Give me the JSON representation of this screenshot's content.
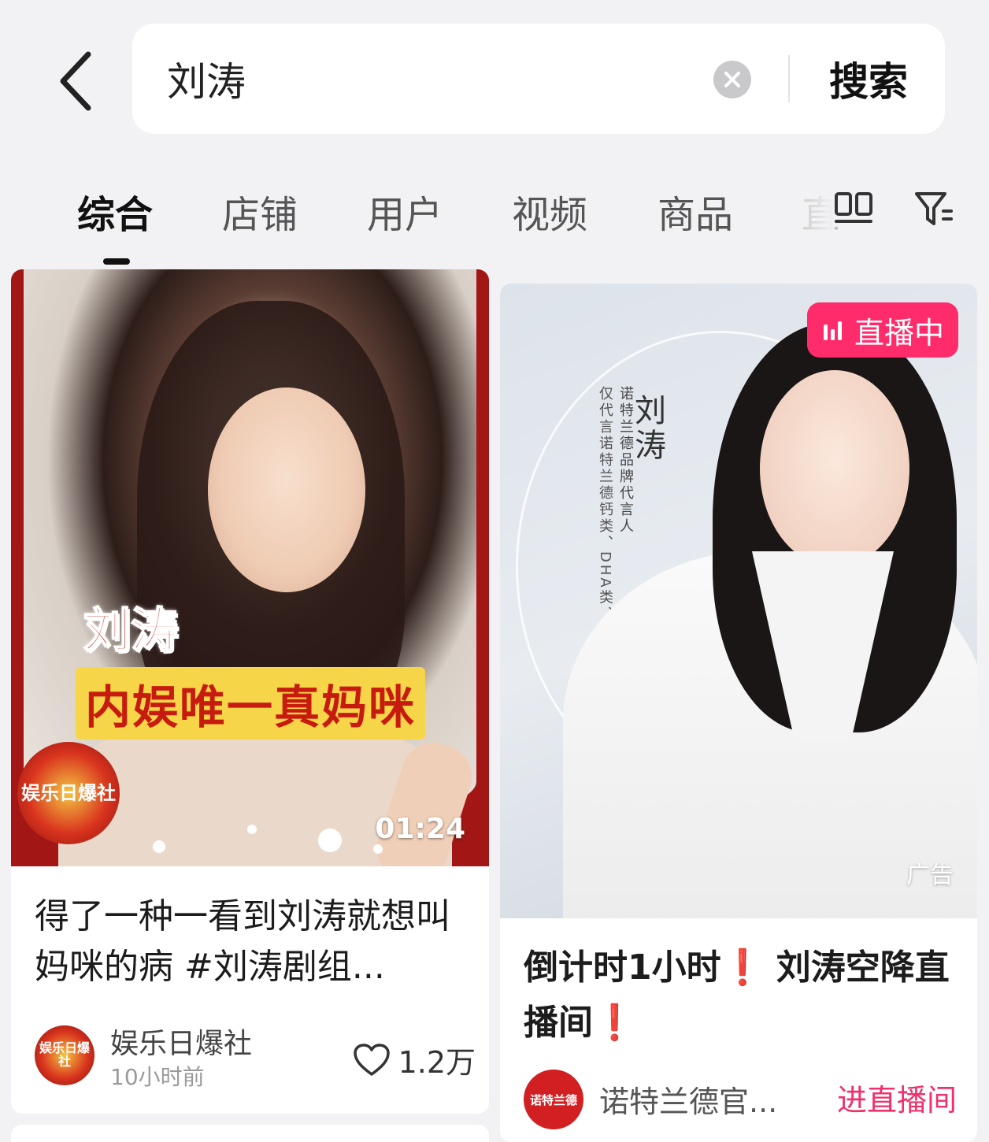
{
  "search": {
    "query": "刘涛",
    "button_label": "搜索"
  },
  "tabs": [
    {
      "label": "综合",
      "active": true
    },
    {
      "label": "店铺",
      "active": false
    },
    {
      "label": "用户",
      "active": false
    },
    {
      "label": "视频",
      "active": false
    },
    {
      "label": "商品",
      "active": false
    },
    {
      "label": "直",
      "active": false
    }
  ],
  "icons": {
    "back": "chevron-left-icon",
    "clear": "clear-circle-icon",
    "layout_toggle": "double-column-layout-icon",
    "filter": "filter-funnel-icon",
    "like": "heart-outline-icon",
    "live": "live-bars-icon"
  },
  "colors": {
    "background": "#f2f2f4",
    "live_badge": "#ff2b6a",
    "live_link": "#f0306c",
    "exclamation": "#e02828",
    "video_frame": "#a31616"
  },
  "cards": {
    "left": {
      "overlay_name": "刘涛",
      "overlay_sub": "内娱唯一真妈咪",
      "logo_text": "娱乐日爆社",
      "duration": "01:24",
      "title": "得了一种一看到刘涛就想叫妈咪的病 #刘涛剧组...",
      "author": "娱乐日爆社",
      "time": "10小时前",
      "likes": "1.2万"
    },
    "right": {
      "live_badge": "直播中",
      "brand_line1": "仅代言诺特兰德钙类、DHA类、益生菌类系列产品",
      "brand_line2": "诺特兰德品牌代言人",
      "brand_name": "刘涛",
      "ad_label": "广告",
      "title_part1": "倒计时1小时",
      "title_part2": "刘涛空降直播间",
      "exclamation": "❗",
      "author": "诺特兰德官...",
      "avatar_text": "诺特兰德",
      "action": "进直播间"
    }
  }
}
